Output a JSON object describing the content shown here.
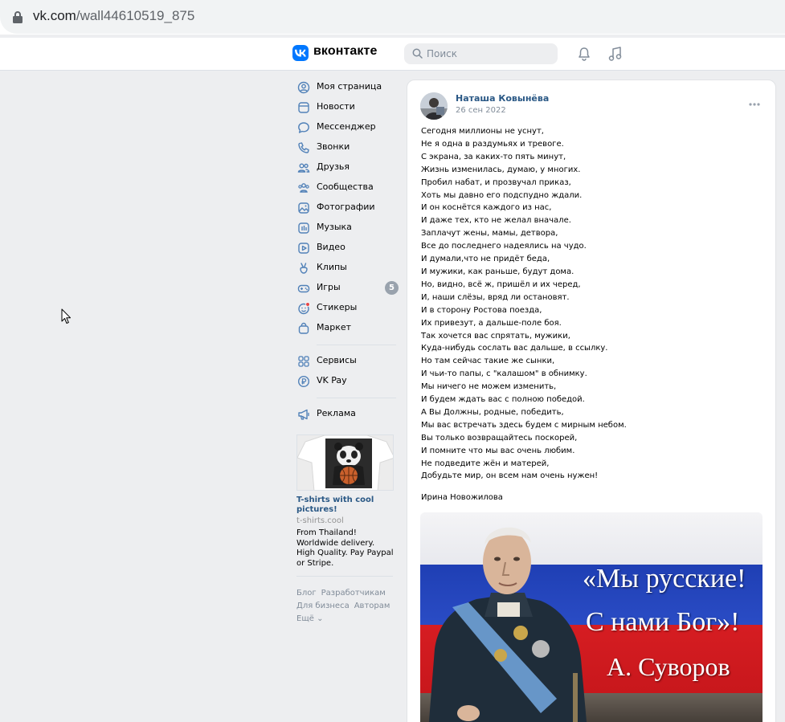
{
  "browser": {
    "url_host": "vk.com",
    "url_path": "/wall44610519_875"
  },
  "header": {
    "wordmark": "вконтакте",
    "search_placeholder": "Поиск"
  },
  "sidebar": {
    "items": [
      {
        "label": "Моя страница",
        "icon": "user-circle-icon"
      },
      {
        "label": "Новости",
        "icon": "news-icon"
      },
      {
        "label": "Мессенджер",
        "icon": "message-icon"
      },
      {
        "label": "Звонки",
        "icon": "phone-icon"
      },
      {
        "label": "Друзья",
        "icon": "friends-icon"
      },
      {
        "label": "Сообщества",
        "icon": "communities-icon"
      },
      {
        "label": "Фотографии",
        "icon": "photo-icon"
      },
      {
        "label": "Музыка",
        "icon": "music-icon"
      },
      {
        "label": "Видео",
        "icon": "video-icon"
      },
      {
        "label": "Клипы",
        "icon": "clips-icon"
      },
      {
        "label": "Игры",
        "icon": "gamepad-icon",
        "badge": "5"
      },
      {
        "label": "Стикеры",
        "icon": "sticker-icon"
      },
      {
        "label": "Маркет",
        "icon": "bag-icon"
      }
    ],
    "services": [
      {
        "label": "Сервисы",
        "icon": "grid-icon"
      },
      {
        "label": "VK Pay",
        "icon": "pay-icon"
      }
    ],
    "ads_link": {
      "label": "Реклама",
      "icon": "megaphone-icon"
    },
    "ad": {
      "title": "T-shirts with cool pictures!",
      "domain": "t-shirts.cool",
      "text": "From Thailand! Worldwide delivery. High Quality. Pay Paypal or Stripe."
    },
    "footer": [
      "Блог",
      "Разработчикам",
      "Для бизнеса",
      "Авторам",
      "Ещё ⌄"
    ]
  },
  "post": {
    "author": "Наташа Ковынёва",
    "date": "26 сен 2022",
    "lines": [
      "Сегодня миллионы не уснут,",
      "Не я одна в раздумьях и тревоге.",
      "С экрана, за каких-то пять минут,",
      "Жизнь изменилась, думаю, у многих.",
      "Пробил набат, и прозвучал приказ,",
      "Хоть мы давно его подспудно ждали.",
      "И он коснётся каждого из нас,",
      "И даже тех, кто не желал вначале.",
      "Заплачут жены, мамы, детвора,",
      "Все до последнего надеялись на чудо.",
      "И думали,что не придёт беда,",
      "И мужики, как раньше, будут дома.",
      "Но, видно, всё ж, пришёл и их черед,",
      "И, наши слёзы, вряд ли остановят.",
      "И в сторону Ростова поезда,",
      "Их привезут, а дальше-поле боя.",
      "Так хочется вас спрятать, мужики,",
      "Куда-нибудь сослать вас дальше, в ссылку.",
      "Но там сейчас такие же сынки,",
      "И чьи-то папы, с \"калашом\" в обнимку.",
      "Мы ничего не можем изменить,",
      "И будем ждать вас с полною победой.",
      "А Вы Должны, родные, победить,",
      "Мы вас встречать здесь будем с мирным небом.",
      "Вы только возвращайтесь поскорей,",
      "И помните что мы вас очень любим.",
      "Не подведите жён и матерей,",
      "Добудьте мир, он всем нам очень нужен!"
    ],
    "signature": "Ирина Новожилова",
    "image_text": {
      "line1": "«Мы русские!",
      "line2": "С нами Бог»!",
      "line3": "А. Суворов"
    }
  }
}
